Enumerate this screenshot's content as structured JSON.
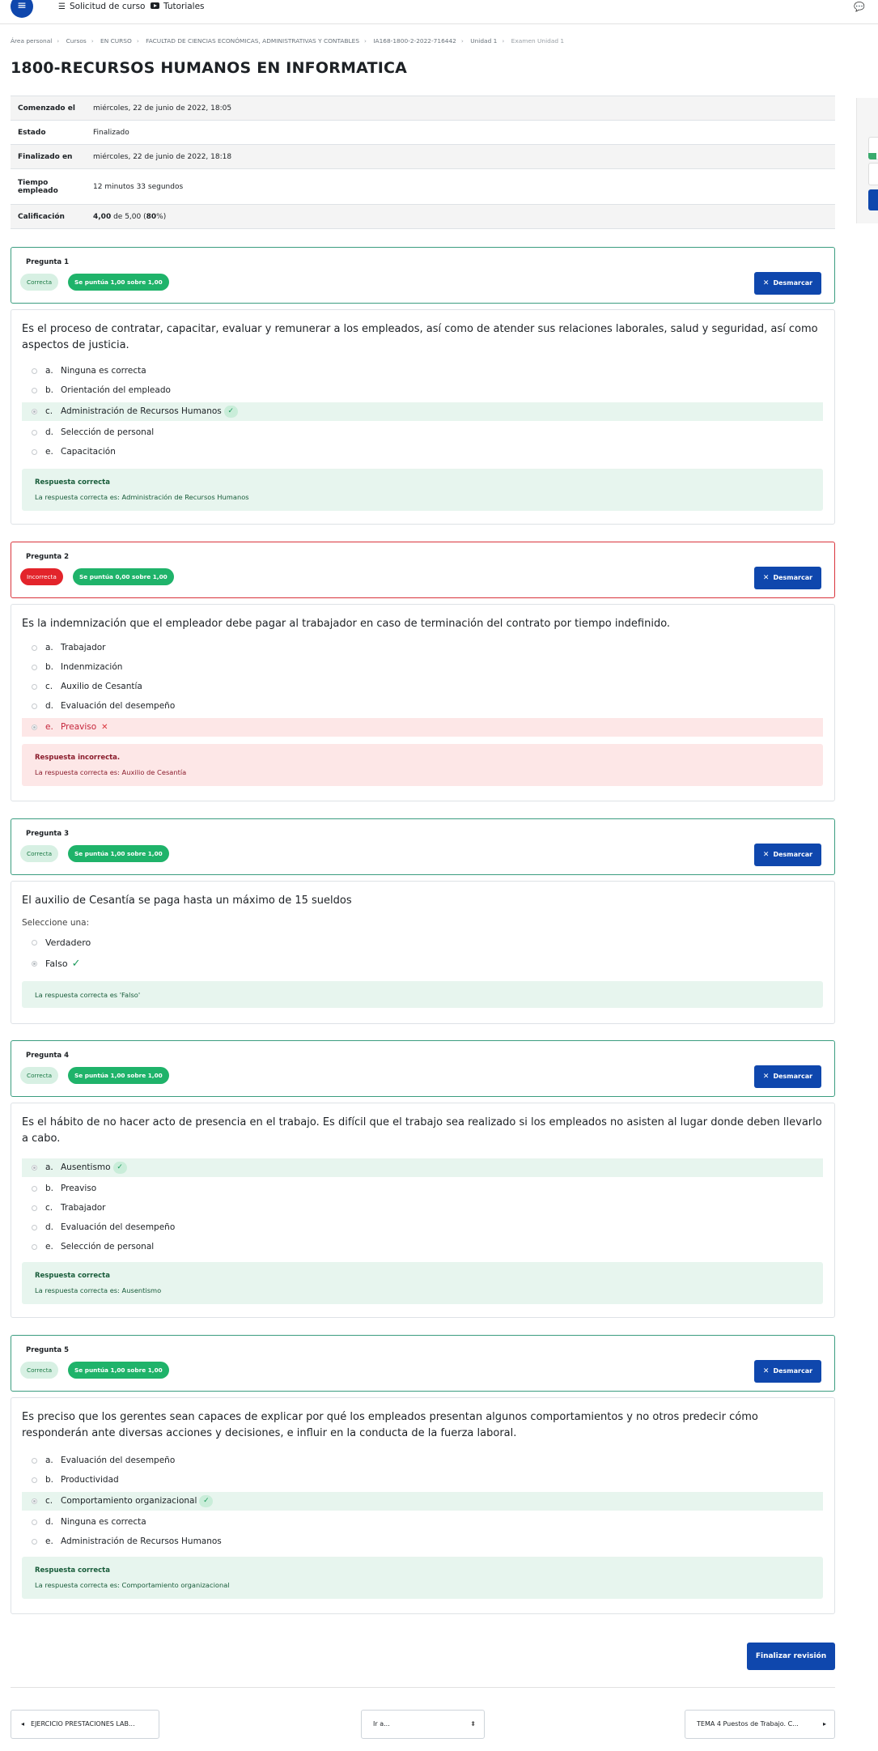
{
  "nav": {
    "menu_icon": "hamburger-icon",
    "links": [
      {
        "label": "Solicitud de curso",
        "icon": "list-icon"
      },
      {
        "label": "Tutoriales",
        "icon": "youtube-icon"
      }
    ],
    "chat_icon": "chat-icon"
  },
  "breadcrumb": [
    "Área personal",
    "Cursos",
    "EN CURSO",
    "FACULTAD DE CIENCIAS ECONÓMICAS, ADMINISTRATIVAS Y CONTABLES",
    "IA168-1800-2-2022-716442",
    "Unidad 1",
    "Examen Unidad 1"
  ],
  "page_title": "1800-RECURSOS HUMANOS EN INFORMATICA",
  "summary": [
    {
      "label": "Comenzado el",
      "value": "miércoles, 22 de junio de 2022, 18:05"
    },
    {
      "label": "Estado",
      "value": "Finalizado"
    },
    {
      "label": "Finalizado en",
      "value": "miércoles, 22 de junio de 2022, 18:18"
    },
    {
      "label": "Tiempo empleado",
      "value": "12 minutos 33 segundos"
    },
    {
      "label": "Calificación",
      "value_bold1": "4,00",
      "value_mid": " de 5,00 (",
      "value_bold2": "80",
      "value_end": "%)"
    }
  ],
  "unflag_label": "Desmarcar",
  "questions": [
    {
      "number": "Pregunta 1",
      "status": "Correcta",
      "score": "Se puntúa 1,00 sobre 1,00",
      "text": "Es el proceso de contratar, capacitar, evaluar y remunerar a los empleados, así como de atender sus relaciones laborales, salud y seguridad, así como aspectos de justicia.",
      "options": [
        {
          "letter": "a.",
          "text": "Ninguna es correcta"
        },
        {
          "letter": "b.",
          "text": "Orientación del empleado"
        },
        {
          "letter": "c.",
          "text": "Administración de Recursos Humanos"
        },
        {
          "letter": "d.",
          "text": "Selección de personal"
        },
        {
          "letter": "e.",
          "text": "Capacitación"
        }
      ],
      "feedback_title": "Respuesta correcta",
      "feedback_text": "La respuesta correcta es: Administración de Recursos Humanos"
    },
    {
      "number": "Pregunta 2",
      "status": "Incorrecta",
      "score": "Se puntúa 0,00 sobre 1,00",
      "text": "Es la indemnización que el empleador debe pagar al trabajador en caso de terminación del contrato por tiempo indefinido.",
      "options": [
        {
          "letter": "a.",
          "text": "Trabajador"
        },
        {
          "letter": "b.",
          "text": "Indenmización"
        },
        {
          "letter": "c.",
          "text": "Auxilio de Cesantía"
        },
        {
          "letter": "d.",
          "text": "Evaluación del desempeño"
        },
        {
          "letter": "e.",
          "text": "Preaviso"
        }
      ],
      "feedback_title": "Respuesta incorrecta.",
      "feedback_text": "La respuesta correcta es: Auxilio de Cesantía"
    },
    {
      "number": "Pregunta 3",
      "status": "Correcta",
      "score": "Se puntúa 1,00 sobre 1,00",
      "text": "El auxilio de Cesantía  se paga hasta un máximo de 15 sueldos",
      "select_label": "Seleccione una:",
      "options": [
        {
          "text": "Verdadero"
        },
        {
          "text": "Falso"
        }
      ],
      "feedback_text": "La respuesta correcta es 'Falso'"
    },
    {
      "number": "Pregunta 4",
      "status": "Correcta",
      "score": "Se puntúa 1,00 sobre 1,00",
      "text": "Es el hábito de no hacer acto de presencia en el trabajo.  Es difícil que el trabajo sea realizado si los empleados no asisten al lugar donde deben llevarlo a cabo.",
      "options": [
        {
          "letter": "a.",
          "text": "Ausentismo"
        },
        {
          "letter": "b.",
          "text": "Preaviso"
        },
        {
          "letter": "c.",
          "text": "Trabajador"
        },
        {
          "letter": "d.",
          "text": "Evaluación del desempeño"
        },
        {
          "letter": "e.",
          "text": "Selección de personal"
        }
      ],
      "feedback_title": "Respuesta correcta",
      "feedback_text": "La respuesta correcta es: Ausentismo"
    },
    {
      "number": "Pregunta 5",
      "status": "Correcta",
      "score": "Se puntúa 1,00 sobre 1,00",
      "text": "Es preciso que los gerentes sean capaces de explicar por qué los empleados presentan algunos comportamientos y no otros predecir cómo responderán ante diversas acciones y decisiones, e influir en la conducta de la fuerza laboral.",
      "options": [
        {
          "letter": "a.",
          "text": "Evaluación del desempeño"
        },
        {
          "letter": "b.",
          "text": "Productividad"
        },
        {
          "letter": "c.",
          "text": "Comportamiento organizacional"
        },
        {
          "letter": "d.",
          "text": "Ninguna es correcta"
        },
        {
          "letter": "e.",
          "text": "Administración de Recursos Humanos"
        }
      ],
      "feedback_title": "Respuesta correcta",
      "feedback_text": "La respuesta correcta es: Comportamiento organizacional"
    }
  ],
  "finish_label": "Finalizar revisión",
  "footer": {
    "prev": "EJERCICIO PRESTACIONES LAB...",
    "jump": "Ir a...",
    "next": "TEMA 4 Puestos de Trabajo. C..."
  },
  "colors": {
    "brand": "#0f47ad",
    "correct": "#1fb36a",
    "incorrect": "#e3242b"
  }
}
